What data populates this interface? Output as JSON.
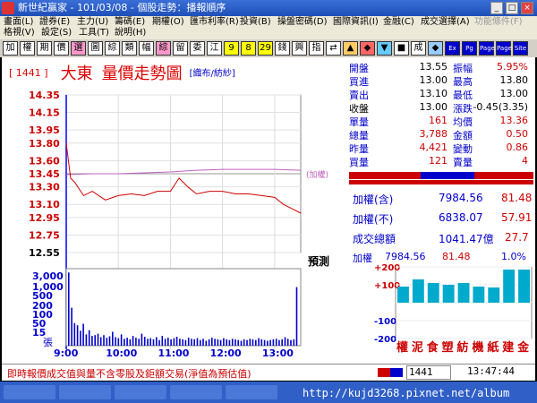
{
  "window": {
    "title": "新世紀贏家 - 101/03/08 - 個股走勢：播報順序",
    "buttons": [
      "_",
      "□",
      "×"
    ]
  },
  "menu": {
    "row1": [
      "畫面(L)",
      "證券(E)",
      "主力(U)",
      "籌碼(E)",
      "期權(O)",
      "匯市利率(R)",
      "投資(B)",
      "操盤密碼(D)",
      "國際資訊(I)",
      "金融(C)",
      "成交選擇(A)",
      "功能條件(F)"
    ],
    "row2": [
      "格視(V)",
      "設定(S)",
      "工具(T)",
      "說明(H)"
    ]
  },
  "toolbar": {
    "buttons": [
      "加",
      "權",
      "期",
      "價",
      "選",
      "圖",
      "綜",
      "類",
      "幅",
      "綜",
      "留",
      "委",
      "江",
      "9",
      "8",
      "29",
      "錢",
      "興",
      "指",
      "⇄",
      "▲",
      "◆",
      "▼",
      "■",
      "成",
      "◆",
      "Ex",
      "Pg",
      "Page",
      "Page",
      "Site"
    ]
  },
  "stock": {
    "code": "[ 1441 ]",
    "name": "大東",
    "chart_title": "量價走勢圖",
    "category": "[織布/紡紗]"
  },
  "quote": {
    "rows": [
      {
        "l1": "開盤",
        "v1": "13.55",
        "l2": "振幅",
        "v2": "5.95%"
      },
      {
        "l1": "買進",
        "v1": "13.00",
        "l2": "最高",
        "v2": "13.80"
      },
      {
        "l1": "賣出",
        "v1": "13.10",
        "l2": "最低",
        "v2": "13.00"
      },
      {
        "l1": "收盤",
        "v1": "13.00",
        "l2": "漲跌",
        "v2": "-0.45(3.35)"
      },
      {
        "l1": "單量",
        "v1": "161",
        "l2": "均價",
        "v2": "13.36"
      },
      {
        "l1": "總量",
        "v1": "3,788",
        "l2": "金額",
        "v2": "0.50"
      },
      {
        "l1": "昨量",
        "v1": "4,421",
        "l2": "變動",
        "v2": "0.86"
      },
      {
        "l1": "買量",
        "v1": "121",
        "l2": "賣量",
        "v2": "4"
      }
    ]
  },
  "index": {
    "incl_label": "加權(含)",
    "incl_value": "7984.56",
    "incl_change": "81.48",
    "excl_label": "加權(不)",
    "excl_value": "6838.07",
    "excl_change": "57.91",
    "turnover_label": "成交總額",
    "turnover_value": "1041.47億",
    "turnover_change": "27.7",
    "bar_label": "加權",
    "bar_value": "7984.56",
    "bar_change": "81.48",
    "bar_pct": "1.0%",
    "sectors": [
      "權",
      "泥",
      "食",
      "塑",
      "紡",
      "機",
      "紙",
      "建",
      "金"
    ]
  },
  "chart_data": [
    {
      "type": "line",
      "title": "量價走勢圖",
      "ylim": [
        12.55,
        14.35
      ],
      "y_ticks": [
        "14.35",
        "14.15",
        "13.95",
        "13.80",
        "13.60",
        "13.45",
        "13.30",
        "13.10",
        "12.95",
        "12.75",
        "12.55"
      ],
      "x_ticks": [
        "9:00",
        "10:00",
        "11:00",
        "12:00",
        "13:00"
      ],
      "series": [
        {
          "name": "加權",
          "color": "#c060c0",
          "x": [
            "9:00",
            "9:30",
            "10:00",
            "10:30",
            "11:00",
            "11:30",
            "12:00",
            "12:30",
            "13:00",
            "13:30"
          ],
          "values": [
            13.44,
            13.45,
            13.45,
            13.46,
            13.47,
            13.49,
            13.5,
            13.5,
            13.5,
            13.49
          ]
        },
        {
          "color": "#d00000",
          "x": [
            "9:00",
            "9:05",
            "9:10",
            "9:20",
            "9:30",
            "9:45",
            "10:00",
            "10:15",
            "10:30",
            "10:45",
            "11:00",
            "11:10",
            "11:20",
            "11:30",
            "11:45",
            "12:00",
            "12:15",
            "12:30",
            "12:45",
            "13:00",
            "13:10",
            "13:20",
            "13:30"
          ],
          "values": [
            13.8,
            13.4,
            13.35,
            13.2,
            13.25,
            13.15,
            13.2,
            13.22,
            13.2,
            13.25,
            13.25,
            13.4,
            13.3,
            13.22,
            13.25,
            13.25,
            13.22,
            13.22,
            13.2,
            13.18,
            13.1,
            13.05,
            13.0
          ]
        }
      ],
      "reference_label": "(加權)",
      "reference_price": 13.45
    },
    {
      "type": "bar",
      "title": "張",
      "y_ticks": [
        "3,000",
        "1,000",
        "500",
        "200",
        "100",
        "50",
        "15"
      ],
      "unit": "張",
      "series": [
        {
          "name": "volume",
          "color": "#0000cc",
          "values": [
            2500,
            900,
            320,
            260,
            140,
            300,
            80,
            150,
            60,
            70,
            90,
            45,
            70,
            40,
            55,
            120,
            45,
            35,
            80,
            30,
            40,
            25,
            60,
            40,
            30,
            90,
            50,
            30,
            35,
            25,
            45,
            20,
            60,
            30,
            40,
            25,
            35,
            50,
            30,
            25,
            20,
            40,
            30,
            25,
            35,
            20,
            30,
            15,
            25,
            40,
            30,
            25,
            20,
            35,
            25,
            20,
            30,
            25,
            20,
            15,
            25,
            20,
            30,
            25,
            20,
            35,
            25,
            20,
            15,
            20,
            25,
            30,
            20,
            25,
            45,
            30,
            20,
            25,
            1500
          ]
        }
      ]
    },
    {
      "type": "bar",
      "ylim": [
        -200,
        200
      ],
      "y_ticks": [
        "+200",
        "+100",
        "0",
        "-100",
        "-200"
      ],
      "categories": [
        "權",
        "泥",
        "食",
        "塑",
        "紡",
        "機",
        "紙",
        "建",
        "金"
      ],
      "series": [
        {
          "name": "sector",
          "color": "#00aacc",
          "values": [
            90,
            130,
            110,
            100,
            110,
            90,
            85,
            185,
            185
          ]
        }
      ]
    }
  ],
  "sidebar_label": "預測",
  "status": {
    "message": "即時報價成交值與量不含零股及鉅額交易(淨值為預估值)",
    "code": "1441",
    "time": "13:47:44"
  },
  "taskbar": {
    "url": "http://kujd3268.pixnet.net/album"
  },
  "colors": {
    "price": "#d00000",
    "index": "#c060c0",
    "volume": "#0000cc",
    "label_blue": "#0000cc",
    "label_red": "#d00000"
  }
}
